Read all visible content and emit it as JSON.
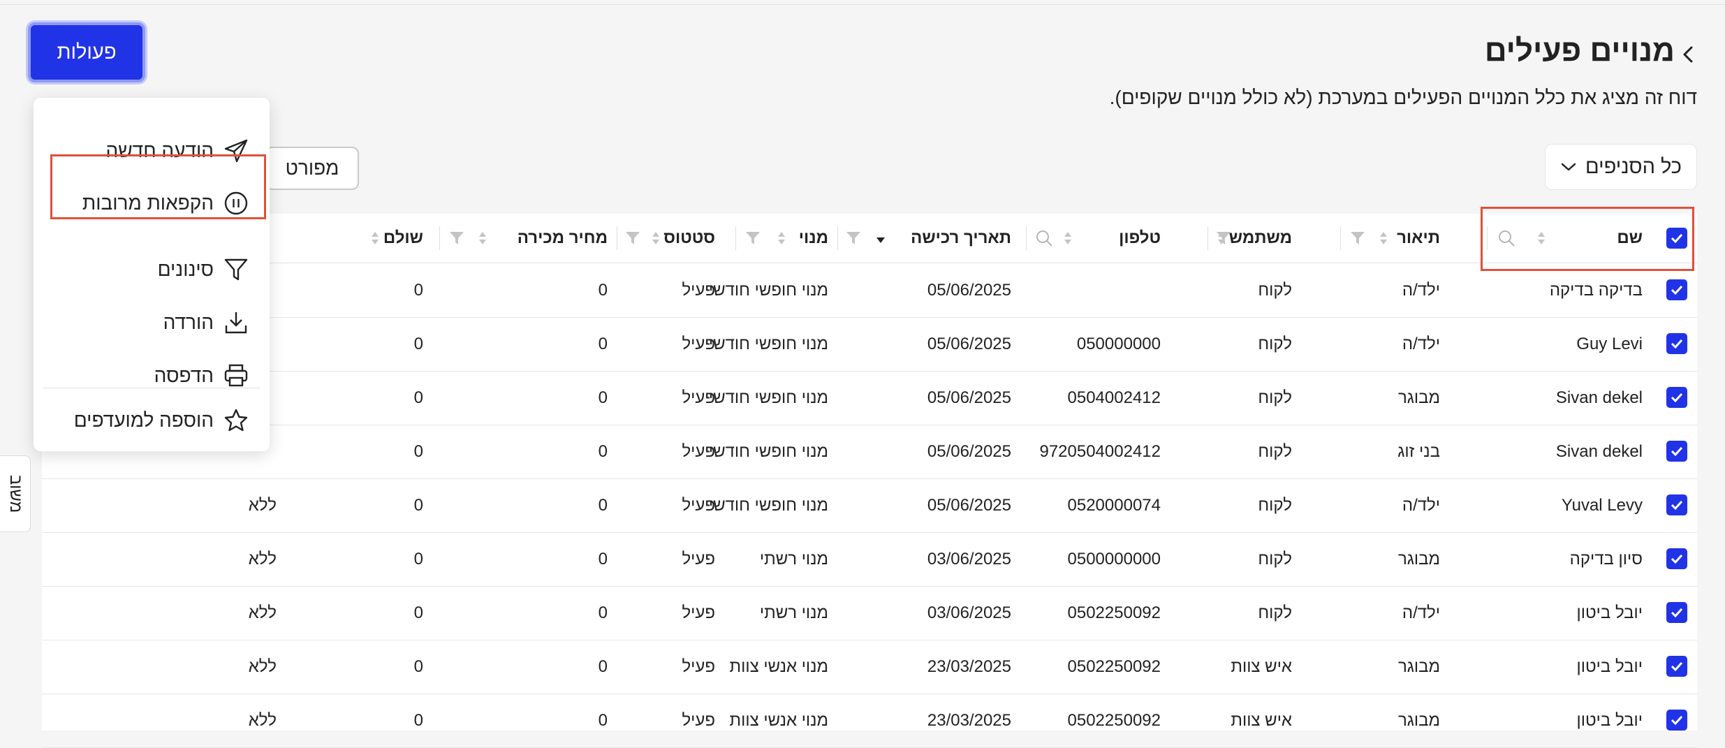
{
  "header": {
    "title": "מנויים פעילים",
    "subtitle": "דוח זה מציג את כלל המנויים הפעילים במערכת (לא כולל מנויים שקופים)."
  },
  "toolbar": {
    "branch_select": "כל הסניפים",
    "export_label": "מפורט",
    "actions_label": "פעולות"
  },
  "actions_menu": {
    "items": [
      {
        "label": "הודעה חדשה",
        "icon": "send-icon"
      },
      {
        "label": "הקפאות מרובות",
        "icon": "pause-icon"
      },
      {
        "label": "סינונים",
        "icon": "filter-icon"
      },
      {
        "label": "הורדה",
        "icon": "download-icon"
      },
      {
        "label": "הדפסה",
        "icon": "print-icon"
      },
      {
        "label": "הוספה למועדפים",
        "icon": "star-icon"
      }
    ]
  },
  "side_tab": {
    "label": "משוב"
  },
  "table": {
    "columns": {
      "name": "שם",
      "description": "תיאור",
      "user": "משתמש",
      "phone": "טלפון",
      "purchase_date": "תאריך רכישה",
      "subscription": "מנוי",
      "status": "סטטוס",
      "sale_price": "מחיר מכירה",
      "paid": "שולם"
    },
    "rows": [
      {
        "name": "בדיקה בדיקה",
        "description": "ילד/ה",
        "user": "לקוח",
        "phone": "",
        "purchase_date": "05/06/2025",
        "subscription": "מנוי חופשי חודשי",
        "status": "פעיל",
        "sale_price": "0",
        "paid": "0",
        "last": ""
      },
      {
        "name": "Guy Levi",
        "description": "ילד/ה",
        "user": "לקוח",
        "phone": "050000000",
        "purchase_date": "05/06/2025",
        "subscription": "מנוי חופשי חודשי",
        "status": "פעיל",
        "sale_price": "0",
        "paid": "0",
        "last": ""
      },
      {
        "name": "Sivan dekel",
        "description": "מבוגר",
        "user": "לקוח",
        "phone": "0504002412",
        "purchase_date": "05/06/2025",
        "subscription": "מנוי חופשי חודשי",
        "status": "פעיל",
        "sale_price": "0",
        "paid": "0",
        "last": ""
      },
      {
        "name": "Sivan dekel",
        "description": "בני זוג",
        "user": "לקוח",
        "phone": "9720504002412",
        "purchase_date": "05/06/2025",
        "subscription": "מנוי חופשי חודשי",
        "status": "פעיל",
        "sale_price": "0",
        "paid": "0",
        "last": ""
      },
      {
        "name": "Yuval Levy",
        "description": "ילד/ה",
        "user": "לקוח",
        "phone": "0520000074",
        "purchase_date": "05/06/2025",
        "subscription": "מנוי חופשי חודשי",
        "status": "פעיל",
        "sale_price": "0",
        "paid": "0",
        "last": "ללא"
      },
      {
        "name": "סיון בדיקה",
        "description": "מבוגר",
        "user": "לקוח",
        "phone": "0500000000",
        "purchase_date": "03/06/2025",
        "subscription": "מנוי רשתי",
        "status": "פעיל",
        "sale_price": "0",
        "paid": "0",
        "last": "ללא"
      },
      {
        "name": "יובל ביטון",
        "description": "ילד/ה",
        "user": "לקוח",
        "phone": "0502250092",
        "purchase_date": "03/06/2025",
        "subscription": "מנוי רשתי",
        "status": "פעיל",
        "sale_price": "0",
        "paid": "0",
        "last": "ללא"
      },
      {
        "name": "יובל ביטון",
        "description": "מבוגר",
        "user": "איש צוות",
        "phone": "0502250092",
        "purchase_date": "23/03/2025",
        "subscription": "מנוי אנשי צוות",
        "status": "פעיל",
        "sale_price": "0",
        "paid": "0",
        "last": "ללא"
      },
      {
        "name": "יובל ביטון",
        "description": "מבוגר",
        "user": "איש צוות",
        "phone": "0502250092",
        "purchase_date": "23/03/2025",
        "subscription": "מנוי אנשי צוות",
        "status": "פעיל",
        "sale_price": "0",
        "paid": "0",
        "last": "ללא"
      }
    ]
  },
  "colors": {
    "accent": "#2133e6",
    "highlight": "#e0503a",
    "background": "#f5f5f5"
  }
}
